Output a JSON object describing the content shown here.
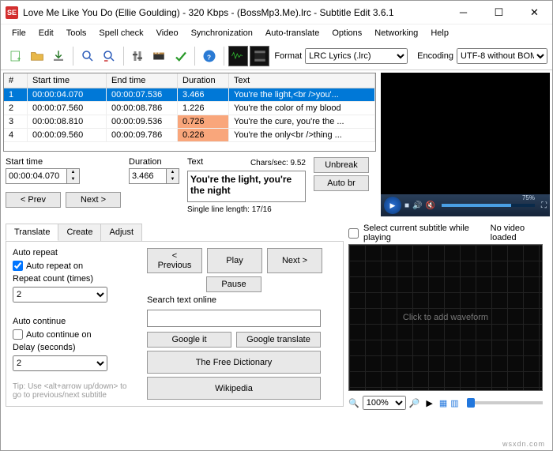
{
  "title": "Love Me Like You Do (Ellie Goulding) - 320 Kbps - (BossMp3.Me).lrc - Subtitle Edit 3.6.1",
  "menu": [
    "File",
    "Edit",
    "Tools",
    "Spell check",
    "Video",
    "Synchronization",
    "Auto-translate",
    "Options",
    "Networking",
    "Help"
  ],
  "format_label": "Format",
  "format_value": "LRC Lyrics (.lrc)",
  "encoding_label": "Encoding",
  "encoding_value": "UTF-8 without BOM",
  "cols": [
    "#",
    "Start time",
    "End time",
    "Duration",
    "Text"
  ],
  "rows": [
    {
      "n": "1",
      "s": "00:00:04.070",
      "e": "00:00:07.536",
      "d": "3.466",
      "t": "You're the light,<br />you'...",
      "sel": true
    },
    {
      "n": "2",
      "s": "00:00:07.560",
      "e": "00:00:08.786",
      "d": "1.226",
      "t": "You're the color of my blood"
    },
    {
      "n": "3",
      "s": "00:00:08.810",
      "e": "00:00:09.536",
      "d": "0.726",
      "t": "You're the cure, you're the ...",
      "warn": true
    },
    {
      "n": "4",
      "s": "00:00:09.560",
      "e": "00:00:09.786",
      "d": "0.226",
      "t": "You're the only<br />thing ...",
      "warn": true
    }
  ],
  "start_label": "Start time",
  "start_val": "00:00:04.070",
  "dur_label": "Duration",
  "dur_val": "3.466",
  "text_label": "Text",
  "chars": "Chars/sec: 9.52",
  "text_val": "You're the light, you're the night",
  "line_len": "Single line length: 17/16",
  "unbreak": "Unbreak",
  "autobr": "Auto br",
  "prev": "< Prev",
  "next": "Next >",
  "tabs": [
    "Translate",
    "Create",
    "Adjust"
  ],
  "auto_repeat": "Auto repeat",
  "auto_repeat_on": "Auto repeat on",
  "repeat_count": "Repeat count (times)",
  "repeat_val": "2",
  "auto_continue": "Auto continue",
  "auto_continue_on": "Auto continue on",
  "delay": "Delay (seconds)",
  "delay_val": "2",
  "tip": "Tip: Use <alt+arrow up/down> to go to previous/next subtitle",
  "nav_prev": "< Previous",
  "nav_play": "Play",
  "nav_next": "Next >",
  "nav_pause": "Pause",
  "search_label": "Search text online",
  "google": "Google it",
  "gtrans": "Google translate",
  "dict": "The Free Dictionary",
  "wiki": "Wikipedia",
  "wave_chk": "Select current subtitle while playing",
  "no_video": "No video loaded",
  "wave_msg": "Click to add waveform",
  "zoom": "100%",
  "progress_pct": "75%",
  "watermark": "wsxdn.com"
}
